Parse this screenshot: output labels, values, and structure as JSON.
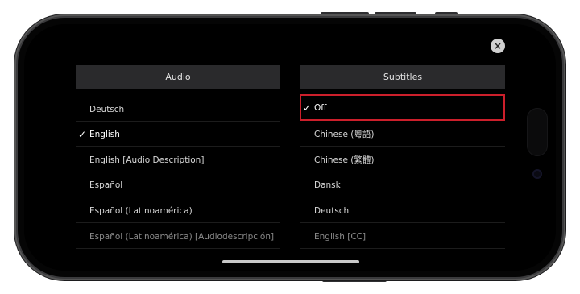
{
  "close_icon": "×",
  "audio": {
    "header": "Audio",
    "items": [
      {
        "label": "Deutsch",
        "selected": false,
        "dimmed": false
      },
      {
        "label": "English",
        "selected": true,
        "dimmed": false
      },
      {
        "label": "English [Audio Description]",
        "selected": false,
        "dimmed": false
      },
      {
        "label": "Español",
        "selected": false,
        "dimmed": false
      },
      {
        "label": "Español (Latinoamérica)",
        "selected": false,
        "dimmed": false
      },
      {
        "label": "Español (Latinoamérica) [Audiodescripción]",
        "selected": false,
        "dimmed": true
      }
    ]
  },
  "subtitles": {
    "header": "Subtitles",
    "items": [
      {
        "label": "Off",
        "selected": true,
        "dimmed": false
      },
      {
        "label": "Chinese (粵語)",
        "selected": false,
        "dimmed": false
      },
      {
        "label": "Chinese (繁體)",
        "selected": false,
        "dimmed": false
      },
      {
        "label": "Dansk",
        "selected": false,
        "dimmed": false
      },
      {
        "label": "Deutsch",
        "selected": false,
        "dimmed": false
      },
      {
        "label": "English [CC]",
        "selected": false,
        "dimmed": true
      }
    ]
  },
  "checkmark": "✓",
  "colors": {
    "highlight": "#cc1f2b",
    "background": "#000000",
    "header_bg": "#2a2a2c"
  }
}
